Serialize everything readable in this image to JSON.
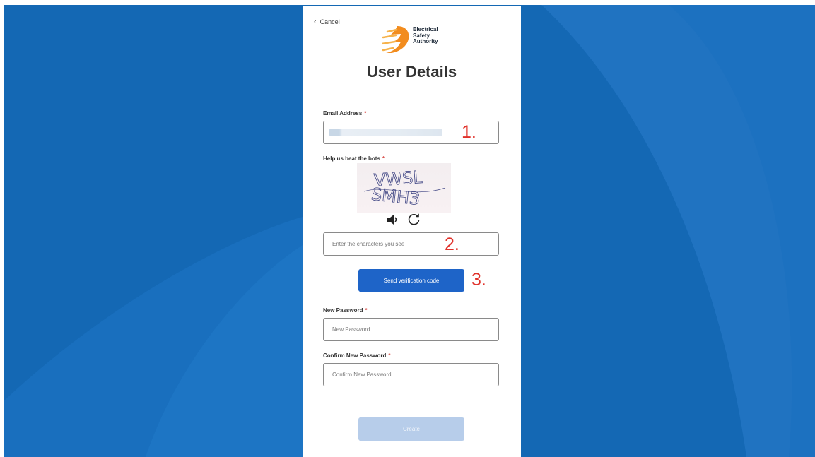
{
  "header": {
    "cancel_label": "Cancel",
    "logo_lines": [
      "Electrical",
      "Safety",
      "Authority"
    ],
    "page_title": "User Details"
  },
  "email": {
    "label": "Email Address",
    "required_mark": "*",
    "annotation": "1."
  },
  "captcha": {
    "label": "Help us beat the bots",
    "required_mark": "*",
    "image_text_line1": "VWSL",
    "image_text_line2": "SMH3",
    "placeholder": "Enter the characters you see",
    "annotation": "2."
  },
  "send_button": {
    "label": "Send verification code",
    "annotation": "3."
  },
  "new_password": {
    "label": "New Password",
    "required_mark": "*",
    "placeholder": "New Password"
  },
  "confirm_password": {
    "label": "Confirm New Password",
    "required_mark": "*",
    "placeholder": "Confirm New Password"
  },
  "create_button": {
    "label": "Create"
  },
  "colors": {
    "background": "#1468b4",
    "primary": "#1e64c8",
    "disabled": "#b7cdea",
    "annotation": "#e0312a"
  }
}
